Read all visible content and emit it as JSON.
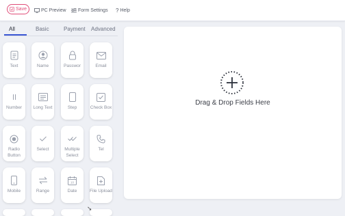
{
  "toolbar": {
    "save_label": "Save",
    "preview_label": "PC Preview",
    "settings_label": "Form Settings",
    "help_label": "Help"
  },
  "tabs": [
    {
      "label": "All",
      "active": true
    },
    {
      "label": "Basic",
      "active": false
    },
    {
      "label": "Payment",
      "active": false
    },
    {
      "label": "Advanced",
      "active": false
    }
  ],
  "fields": [
    {
      "label": "Text",
      "icon": "text-doc-icon"
    },
    {
      "label": "Name",
      "icon": "person-icon"
    },
    {
      "label": "Passwor",
      "icon": "lock-icon"
    },
    {
      "label": "Email",
      "icon": "envelope-icon"
    },
    {
      "label": "Number",
      "icon": "number-icon"
    },
    {
      "label": "Long Text",
      "icon": "long-text-icon"
    },
    {
      "label": "Step",
      "icon": "step-icon"
    },
    {
      "label": "Check Box",
      "icon": "checkbox-icon"
    },
    {
      "label": "Radio Button",
      "icon": "radio-icon"
    },
    {
      "label": "Select",
      "icon": "check-icon"
    },
    {
      "label": "Multiple Select",
      "icon": "double-check-icon"
    },
    {
      "label": "Tel",
      "icon": "phone-icon"
    },
    {
      "label": "Mobile",
      "icon": "mobile-icon"
    },
    {
      "label": "Range",
      "icon": "range-icon"
    },
    {
      "label": "Date",
      "icon": "calendar-icon"
    },
    {
      "label": "File Upload",
      "icon": "file-upload-icon"
    }
  ],
  "canvas": {
    "drop_text": "Drag & Drop Fields Here"
  },
  "colors": {
    "accent": "#e04b77",
    "tab_active": "#3a56d4"
  }
}
